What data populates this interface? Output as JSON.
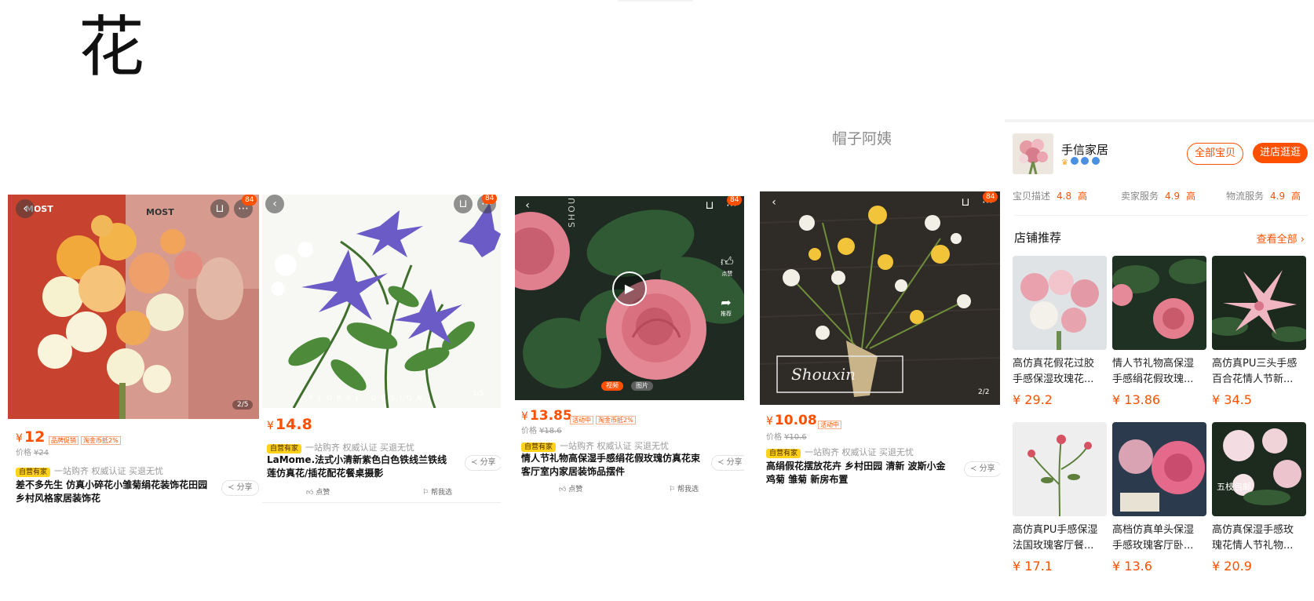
{
  "heading": "花",
  "watermark": "帽子阿姨",
  "colors": {
    "accent": "#ff5000",
    "badge_yellow": "#ffd31a"
  },
  "overlay_icons": {
    "back": "back-arrow-icon",
    "cart": "cart-icon",
    "more": "more-dots-icon"
  },
  "products": [
    {
      "badge": "84",
      "brand_text": "MOST",
      "page_indicator": "2/5",
      "price_symbol": "¥",
      "price": "12",
      "promo_tags": [
        "品牌促销",
        "淘金币抵2%"
      ],
      "orig_label": "价格",
      "orig_price": "¥24",
      "tag_badge": "自营有家",
      "tagline": "一站购齐 权威认证 买退无忧",
      "title": "差不多先生 仿真小碎花小雏菊绢花装饰花田园乡村风格家居装饰花",
      "share": "分享"
    },
    {
      "badge": "84",
      "page_indicator": "1/5",
      "price_symbol": "¥",
      "price": "14.8",
      "tag_badge": "自营有家",
      "tagline": "一站购齐 权威认证 买退无忧",
      "title": "LaMome.法式小清新紫色白色铁线兰铁线莲仿真花/插花配花餐桌摄影",
      "share": "分享",
      "like": "点赞",
      "help": "帮我选"
    },
    {
      "badge": "84",
      "photo_text": "SHOUXIN",
      "video_pill": "视频",
      "image_pill": "图片",
      "like_side": "点赞",
      "rec_side": "推荐",
      "price_symbol": "¥",
      "price": "13.85",
      "promo_tags": [
        "活动中",
        "淘金币抵2%"
      ],
      "orig_label": "价格",
      "orig_price": "¥18.6",
      "tag_badge": "自营有家",
      "tagline": "一站购齐 权威认证 买退无忧",
      "title": "情人节礼物高保湿手感绢花假玫瑰仿真花束客厅室内家居装饰品摆件",
      "share": "分享",
      "like": "点赞",
      "help": "帮我选"
    },
    {
      "badge": "84",
      "photo_text": "Shouxin",
      "page_indicator": "2/2",
      "price_symbol": "¥",
      "price": "10.08",
      "promo_tags": [
        "活动中"
      ],
      "orig_label": "价格",
      "orig_price": "¥10.6",
      "tag_badge": "自营有家",
      "tagline": "一站购齐 权威认证 买退无忧",
      "title": "高绢假花摆放花卉 乡村田园 清新 波斯小金鸡菊 雏菊  新房布置",
      "share": "分享"
    }
  ],
  "store": {
    "name": "手信家居",
    "all_items_btn": "全部宝贝",
    "enter_store_btn": "进店逛逛",
    "ratings": [
      {
        "label": "宝贝描述",
        "score": "4.8",
        "level": "高"
      },
      {
        "label": "卖家服务",
        "score": "4.9",
        "level": "高"
      },
      {
        "label": "物流服务",
        "score": "4.9",
        "level": "高"
      }
    ],
    "section_title": "店铺推荐",
    "view_all": "查看全部",
    "recommendations": [
      {
        "title_line1": "高仿真花假花过胶",
        "title_line2": "手感保湿玫瑰花...",
        "price": "¥ 29.2"
      },
      {
        "title_line1": "情人节礼物高保湿",
        "title_line2": "手感绢花假玫瑰...",
        "price": "¥ 13.86"
      },
      {
        "title_line1": "高仿真PU三头手感",
        "title_line2": "百合花情人节新...",
        "price": "¥ 34.5"
      },
      {
        "title_line1": "高仿真PU手感保湿",
        "title_line2": "法国玫瑰客厅餐...",
        "price": "¥ 17.1"
      },
      {
        "title_line1": "高档仿真单头保湿",
        "title_line2": "手感玫瑰客厅卧...",
        "price": "¥ 13.6"
      },
      {
        "title_line1": "高仿真保湿手感玫",
        "title_line2": "瑰花情人节礼物...",
        "price": "¥ 20.9"
      }
    ],
    "rec_photo_text": "五枝包邮"
  }
}
